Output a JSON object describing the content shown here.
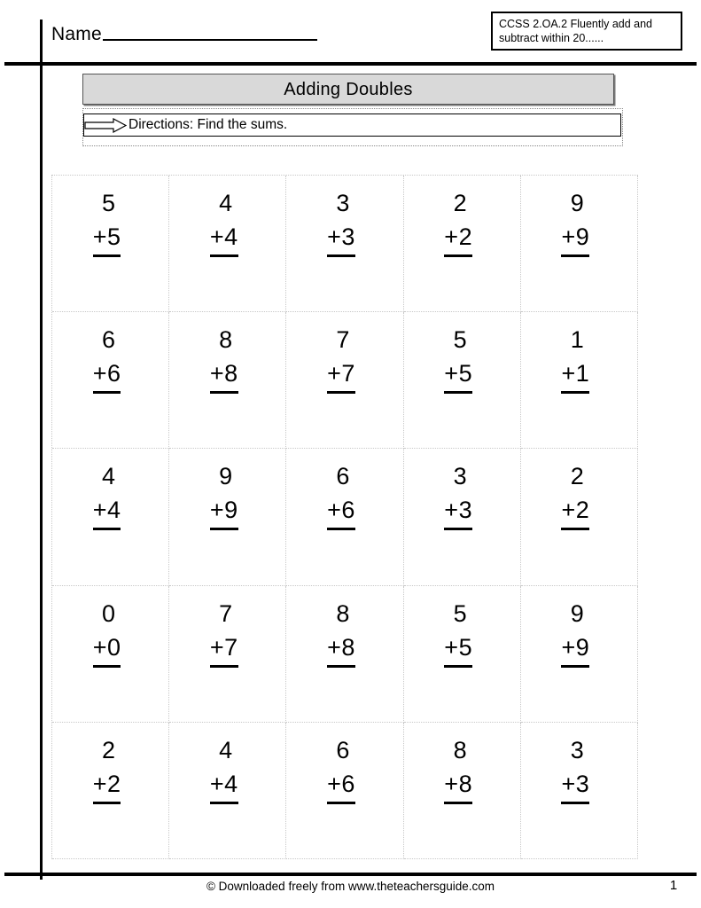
{
  "header": {
    "name_label": "Name",
    "name_blank": "",
    "ccss_text": "CCSS  2.OA.2  Fluently add and subtract within 20......"
  },
  "title": {
    "text": "Adding Doubles"
  },
  "directions": {
    "arrow_icon": "right-arrow-icon",
    "text": "Directions: Find the sums."
  },
  "grid": {
    "columns": 5,
    "rows": 5,
    "problems": [
      {
        "top": "5",
        "bottom": "+5"
      },
      {
        "top": "4",
        "bottom": "+4"
      },
      {
        "top": "3",
        "bottom": "+3"
      },
      {
        "top": "2",
        "bottom": "+2"
      },
      {
        "top": "9",
        "bottom": "+9"
      },
      {
        "top": "6",
        "bottom": "+6"
      },
      {
        "top": "8",
        "bottom": "+8"
      },
      {
        "top": "7",
        "bottom": "+7"
      },
      {
        "top": "5",
        "bottom": "+5"
      },
      {
        "top": "1",
        "bottom": "+1"
      },
      {
        "top": "4",
        "bottom": "+4"
      },
      {
        "top": "9",
        "bottom": "+9"
      },
      {
        "top": "6",
        "bottom": "+6"
      },
      {
        "top": "3",
        "bottom": "+3"
      },
      {
        "top": "2",
        "bottom": "+2"
      },
      {
        "top": "0",
        "bottom": "+0"
      },
      {
        "top": "7",
        "bottom": "+7"
      },
      {
        "top": "8",
        "bottom": "+8"
      },
      {
        "top": "5",
        "bottom": "+5"
      },
      {
        "top": "9",
        "bottom": "+9"
      },
      {
        "top": "2",
        "bottom": "+2"
      },
      {
        "top": "4",
        "bottom": "+4"
      },
      {
        "top": "6",
        "bottom": "+6"
      },
      {
        "top": "8",
        "bottom": "+8"
      },
      {
        "top": "3",
        "bottom": "+3"
      }
    ]
  },
  "footer": {
    "credit": "© Downloaded freely from www.theteachersguide.com",
    "page_number": "1"
  },
  "colors": {
    "ink": "#000000",
    "banner_fill": "#d9d9d9",
    "grid_line": "#c8c8c8",
    "paper": "#ffffff"
  }
}
